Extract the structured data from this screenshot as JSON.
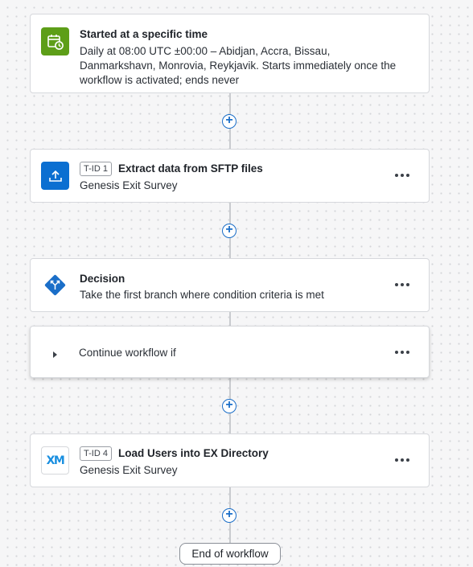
{
  "trigger": {
    "title": "Started at a specific time",
    "description_line1": "Daily at 08:00 UTC ±00:00 – Abidjan, Accra, Bissau,",
    "description_line2": "Danmarkshavn, Monrovia, Reykjavik. Starts immediately once the",
    "description_line3": "workflow is activated; ends never",
    "icon": "calendar-clock-icon",
    "icon_color": "#5d9e18"
  },
  "extract_task": {
    "tid": "T-ID 1",
    "title": "Extract data from SFTP files",
    "subtitle": "Genesis Exit Survey",
    "icon": "upload-icon",
    "icon_color": "#0b6fd1"
  },
  "decision": {
    "title": "Decision",
    "subtitle": "Take the first branch where condition criteria is met",
    "icon": "decision-diamond-icon",
    "icon_color": "#1a6ec8"
  },
  "branch": {
    "label": "Continue workflow if",
    "icon": "chevron-right-icon"
  },
  "load_task": {
    "tid": "T-ID 4",
    "title": "Load Users into EX Directory",
    "subtitle": "Genesis Exit Survey",
    "logo_text": "XM",
    "logo_color": "#1a8fe0"
  },
  "add_step_symbol": "+",
  "end": {
    "label": "End of workflow"
  }
}
